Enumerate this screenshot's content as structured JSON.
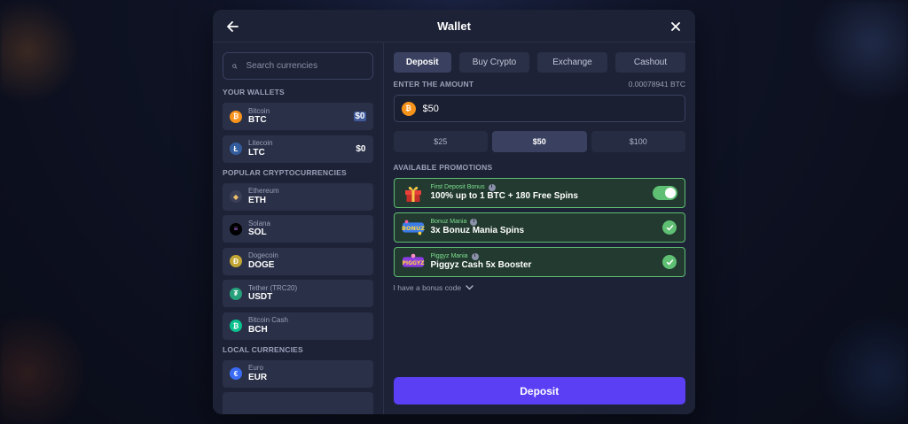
{
  "modal": {
    "title": "Wallet"
  },
  "search": {
    "placeholder": "Search currencies"
  },
  "sections": {
    "your_wallets": "YOUR WALLETS",
    "popular": "POPULAR CRYPTOCURRENCIES",
    "local": "LOCAL CURRENCIES"
  },
  "wallets": [
    {
      "name": "Bitcoin",
      "code": "BTC",
      "balance": "$0",
      "icon": "bitcoin-icon",
      "color": "#f7931a",
      "glyph": "₿"
    },
    {
      "name": "Litecoin",
      "code": "LTC",
      "balance": "$0",
      "icon": "litecoin-icon",
      "color": "#345d9d",
      "glyph": "Ł"
    }
  ],
  "popular": [
    {
      "name": "Ethereum",
      "code": "ETH",
      "icon": "ethereum-icon",
      "color": "#3b3f58",
      "glyph": "◆"
    },
    {
      "name": "Solana",
      "code": "SOL",
      "icon": "solana-icon",
      "color": "#000000",
      "glyph": "≡"
    },
    {
      "name": "Dogecoin",
      "code": "DOGE",
      "icon": "dogecoin-icon",
      "color": "#c2a633",
      "glyph": "Ð"
    },
    {
      "name": "Tether (TRC20)",
      "code": "USDT",
      "icon": "tether-icon",
      "color": "#26a17b",
      "glyph": "₮"
    },
    {
      "name": "Bitcoin Cash",
      "code": "BCH",
      "icon": "bitcoin-cash-icon",
      "color": "#0ac18e",
      "glyph": "₿"
    }
  ],
  "local": [
    {
      "name": "Euro",
      "code": "EUR",
      "icon": "euro-icon",
      "color": "#3b6cf6",
      "glyph": "€"
    }
  ],
  "tabs": [
    {
      "label": "Deposit",
      "active": true
    },
    {
      "label": "Buy Crypto",
      "active": false
    },
    {
      "label": "Exchange",
      "active": false
    },
    {
      "label": "Cashout",
      "active": false
    }
  ],
  "amount": {
    "label": "ENTER THE AMOUNT",
    "btc_equivalent": "0.00078941 BTC",
    "value": "$50"
  },
  "presets": [
    {
      "label": "$25",
      "active": false
    },
    {
      "label": "$50",
      "active": true
    },
    {
      "label": "$100",
      "active": false
    }
  ],
  "promotions": {
    "label": "AVAILABLE PROMOTIONS",
    "items": [
      {
        "title": "First Deposit Bonus",
        "description": "100% up to 1 BTC + 180 Free Spins",
        "control": "toggle",
        "enabled": true,
        "icon": "gift-icon"
      },
      {
        "title": "Bonuz Mania",
        "description": "3x Bonuz Mania Spins",
        "control": "check",
        "enabled": true,
        "icon": "bonuz-mania-logo"
      },
      {
        "title": "Piggyz Mania",
        "description": "Piggyz Cash 5x Booster",
        "control": "check",
        "enabled": true,
        "icon": "piggyz-mania-logo"
      }
    ],
    "bonus_code": "I have a bonus code"
  },
  "deposit_button": "Deposit",
  "colors": {
    "accent": "#5b3ff5",
    "promo_border": "#5fbf73",
    "panel": "#1d2236"
  }
}
